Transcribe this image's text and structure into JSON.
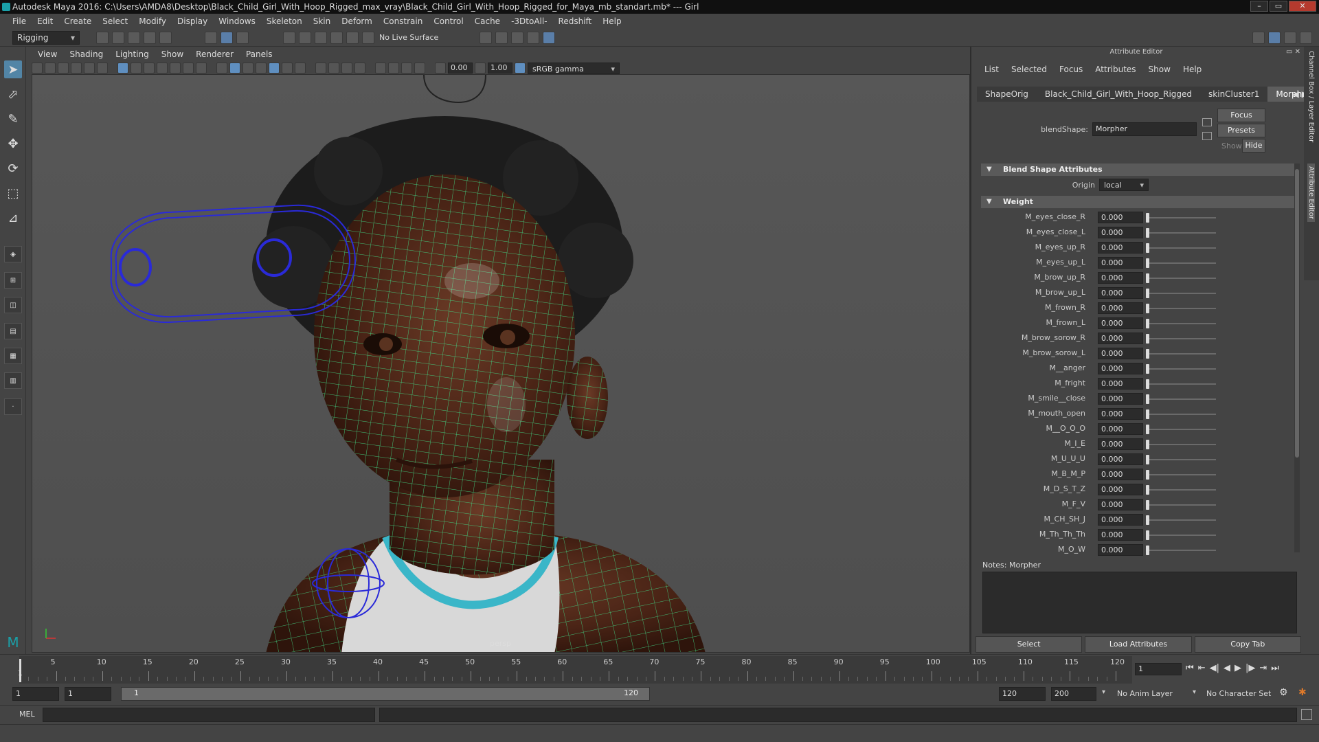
{
  "window": {
    "title": "Autodesk Maya 2016: C:\\Users\\AMDA8\\Desktop\\Black_Child_Girl_With_Hoop_Rigged_max_vray\\Black_Child_Girl_With_Hoop_Rigged_for_Maya_mb_standart.mb*   ---   Girl",
    "controls": [
      "–",
      "▭",
      "✕"
    ]
  },
  "menubar": [
    "File",
    "Edit",
    "Create",
    "Select",
    "Modify",
    "Display",
    "Windows",
    "Skeleton",
    "Skin",
    "Deform",
    "Constrain",
    "Control",
    "Cache",
    "-3DtoAll-",
    "Redshift",
    "Help"
  ],
  "shelf": {
    "mode": "Rigging",
    "live_surface": "No Live Surface"
  },
  "viewport": {
    "menus": [
      "View",
      "Shading",
      "Lighting",
      "Show",
      "Renderer",
      "Panels"
    ],
    "exposure": "0.00",
    "gamma": "1.00",
    "color_space": "sRGB gamma",
    "camera": "persp"
  },
  "attribute_editor": {
    "title": "Attribute Editor",
    "menus": [
      "List",
      "Selected",
      "Focus",
      "Attributes",
      "Show",
      "Help"
    ],
    "tabs": [
      "ShapeOrig",
      "Black_Child_Girl_With_Hoop_Rigged",
      "skinCluster1",
      "Morpher"
    ],
    "active_tab": "Morpher",
    "node_label": "blendShape:",
    "node_name": "Morpher",
    "buttons": {
      "focus": "Focus",
      "presets": "Presets",
      "show": "Show",
      "hide": "Hide"
    },
    "section_blend": "Blend Shape Attributes",
    "origin_label": "Origin",
    "origin_value": "local",
    "section_weight": "Weight",
    "weights": [
      {
        "name": "M_eyes_close_R",
        "value": "0.000"
      },
      {
        "name": "M_eyes_close_L",
        "value": "0.000"
      },
      {
        "name": "M_eyes_up_R",
        "value": "0.000"
      },
      {
        "name": "M_eyes_up_L",
        "value": "0.000"
      },
      {
        "name": "M_brow_up_R",
        "value": "0.000"
      },
      {
        "name": "M_brow_up_L",
        "value": "0.000"
      },
      {
        "name": "M_frown_R",
        "value": "0.000"
      },
      {
        "name": "M_frown_L",
        "value": "0.000"
      },
      {
        "name": "M_brow_sorow_R",
        "value": "0.000"
      },
      {
        "name": "M_brow_sorow_L",
        "value": "0.000"
      },
      {
        "name": "M__anger",
        "value": "0.000"
      },
      {
        "name": "M_fright",
        "value": "0.000"
      },
      {
        "name": "M_smile__close",
        "value": "0.000"
      },
      {
        "name": "M_mouth_open",
        "value": "0.000"
      },
      {
        "name": "M__O_O_O",
        "value": "0.000"
      },
      {
        "name": "M_I_E",
        "value": "0.000"
      },
      {
        "name": "M_U_U_U",
        "value": "0.000"
      },
      {
        "name": "M_B_M_P",
        "value": "0.000"
      },
      {
        "name": "M_D_S_T_Z",
        "value": "0.000"
      },
      {
        "name": "M_F_V",
        "value": "0.000"
      },
      {
        "name": "M_CH_SH_J",
        "value": "0.000"
      },
      {
        "name": "M_Th_Th_Th",
        "value": "0.000"
      },
      {
        "name": "M_O_W",
        "value": "0.000"
      }
    ],
    "notes_label": "Notes:  Morpher",
    "bottom_buttons": [
      "Select",
      "Load Attributes",
      "Copy Tab"
    ],
    "side_tabs": [
      "Channel Box / Layer Editor",
      "Attribute Editor"
    ]
  },
  "timeline": {
    "ticks": [
      "5",
      "10",
      "15",
      "20",
      "25",
      "30",
      "35",
      "40",
      "45",
      "50",
      "55",
      "60",
      "65",
      "70",
      "75",
      "80",
      "85",
      "90",
      "95",
      "100",
      "105",
      "110",
      "115",
      "120"
    ],
    "start_label": "1",
    "current_frame": "1",
    "playback": [
      "⏮",
      "⇤",
      "◀|",
      "◀",
      "▶",
      "|▶",
      "⇥",
      "⏭"
    ]
  },
  "range": {
    "start": "1",
    "playback_start": "1",
    "range_start": "1",
    "range_end": "120",
    "playback_end": "120",
    "end": "200",
    "anim_layer": "No Anim Layer",
    "character_set": "No Character Set"
  },
  "cmdline": {
    "label": "MEL"
  }
}
